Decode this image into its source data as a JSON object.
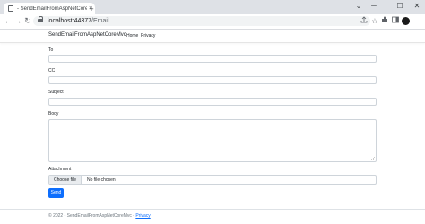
{
  "browser": {
    "tab_title": "- SendEmailFromAspNetCoreMv",
    "tab_close": "×",
    "new_tab": "+",
    "window_minimize": "─",
    "window_restore": "☐",
    "window_close": "✕",
    "window_chevron": "⌄",
    "back": "←",
    "forward": "→",
    "reload": "↻",
    "url_host": "localhost:44377",
    "url_path": "/Email",
    "icons": [
      "share-icon",
      "star-icon",
      "extensions-icon",
      "sidebar-icon",
      "profile-avatar"
    ]
  },
  "site": {
    "brand": "SendEmailFromAspNetCoreMvc",
    "nav": [
      "Home",
      "Privacy"
    ]
  },
  "form": {
    "to_label": "To",
    "cc_label": "CC",
    "subject_label": "Subject",
    "body_label": "Body",
    "attachment_label": "Attachment",
    "choose_file": "Choose file",
    "no_file": "No file chosen",
    "send": "Send"
  },
  "footer": {
    "text": "© 2022 - SendEmailFromAspNetCoreMvc - ",
    "privacy": "Privacy"
  },
  "colors": {
    "primary": "#0d6efd",
    "tabstrip": "#dee1e6"
  }
}
